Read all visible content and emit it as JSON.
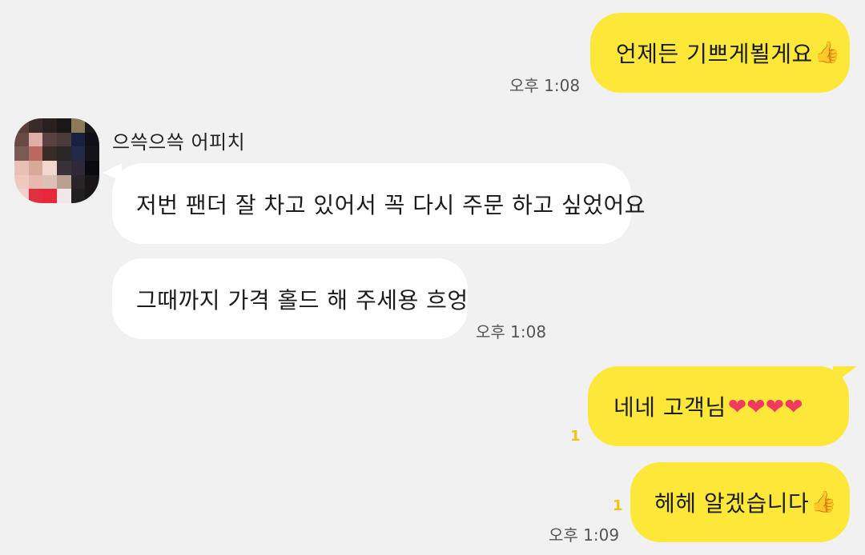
{
  "messages": [
    {
      "id": "m1",
      "text": "언제든 기쁘게뵐게요",
      "emoji": "👍",
      "time": "오후 1:08"
    },
    {
      "id": "m2",
      "text": "저번 팬더 잘 차고 있어서 꼭 다시 주문 하고 싶었어요"
    },
    {
      "id": "m3",
      "text": "그때까지 가격 홀드 해 주세용 흐엉",
      "time": "오후 1:08"
    },
    {
      "id": "m4",
      "text": "네네 고객님",
      "emoji": "❤❤❤❤",
      "unread": "1"
    },
    {
      "id": "m5",
      "text": "헤헤 알겠습니다",
      "emoji": "👍",
      "unread": "1",
      "time": "오후 1:09"
    }
  ],
  "sender": {
    "name": "으쓱으쓱 어피치"
  },
  "colors": {
    "background": "#f1f1f1",
    "my_bubble": "#fde739",
    "their_bubble": "#ffffff",
    "unread": "#f0c419"
  }
}
